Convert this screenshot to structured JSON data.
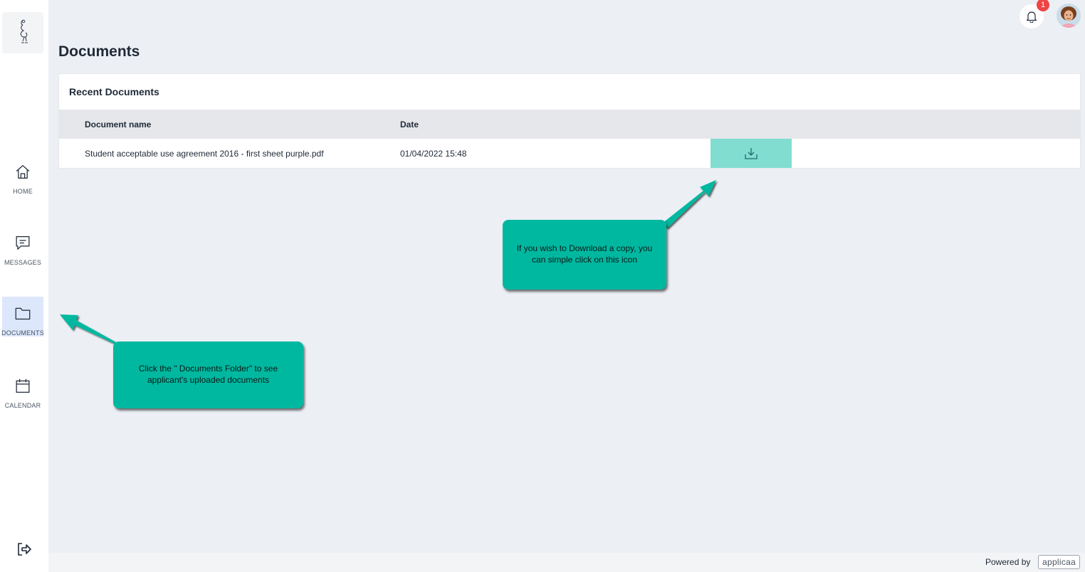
{
  "app": {
    "logo_icon": "bird-sketch-logo"
  },
  "sidebar": {
    "items": [
      {
        "label": "HOME",
        "icon": "home-icon"
      },
      {
        "label": "MESSAGES",
        "icon": "message-icon"
      },
      {
        "label": "DOCUMENTS",
        "icon": "folder-icon",
        "active": true
      },
      {
        "label": "CALENDAR",
        "icon": "calendar-icon"
      }
    ],
    "logout_icon": "logout-icon"
  },
  "header": {
    "notification_count": "1"
  },
  "page": {
    "title": "Documents"
  },
  "recent_documents": {
    "title": "Recent Documents",
    "columns": [
      "Document name",
      "Date"
    ],
    "rows": [
      {
        "name": "Student acceptable use agreement 2016 - first sheet purple.pdf",
        "date": "01/04/2022 15:48"
      }
    ]
  },
  "callouts": {
    "download": "If you wish to Download a copy, you can simple click on this icon",
    "documents": "Click the \" Documents Folder\" to see applicant's uploaded documents"
  },
  "footer": {
    "powered_by": "Powered by",
    "brand": "applicaa"
  },
  "colors": {
    "accent": "#00b8a0",
    "download_button": "#80ddd0",
    "badge": "#ef4444",
    "active_nav": "#dde7fb"
  }
}
